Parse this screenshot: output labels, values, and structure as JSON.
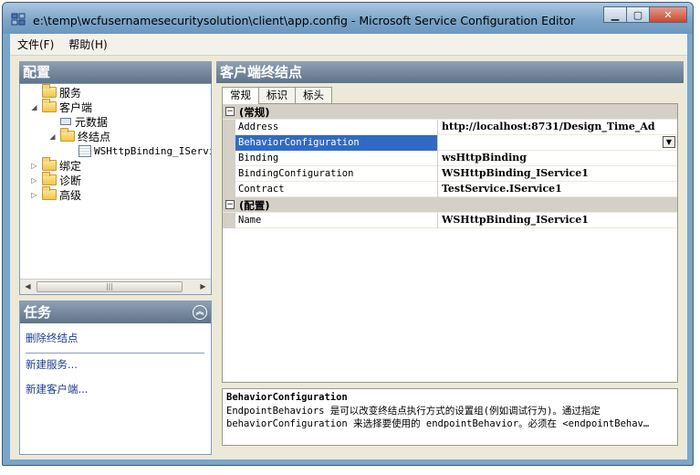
{
  "window": {
    "title": "e:\\temp\\wcfusernamesecuritysolution\\client\\app.config - Microsoft Service Configuration Editor",
    "controls": {
      "minimize": "▁",
      "maximize": "▢",
      "close": "✕"
    }
  },
  "menu": {
    "items": [
      "文件(F)",
      "帮助(H)"
    ]
  },
  "config_panel": {
    "title": "配置",
    "tree": [
      {
        "label": "服务",
        "level": 0,
        "icon": "folder-icon"
      },
      {
        "label": "客户端",
        "level": 0,
        "icon": "folder-icon",
        "expanded": true
      },
      {
        "label": "元数据",
        "level": 1,
        "icon": "metadata-icon"
      },
      {
        "label": "终结点",
        "level": 1,
        "icon": "folder-icon",
        "expanded": true
      },
      {
        "label": "WSHttpBinding_IServic",
        "level": 2,
        "icon": "endpoint-icon"
      },
      {
        "label": "绑定",
        "level": 0,
        "icon": "folder-icon"
      },
      {
        "label": "诊断",
        "level": 0,
        "icon": "folder-icon"
      },
      {
        "label": "高级",
        "level": 0,
        "icon": "folder-icon"
      }
    ]
  },
  "tasks_panel": {
    "title": "任务",
    "links": [
      "删除终结点",
      "新建服务...",
      "新建客户端..."
    ]
  },
  "endpoint_panel": {
    "title": "客户端终结点",
    "tabs": [
      "常规",
      "标识",
      "标头"
    ],
    "active_tab": "常规",
    "categories": [
      {
        "label": "(常规)",
        "rows": [
          {
            "name": "Address",
            "value": "http://localhost:8731/Design_Time_Ad"
          },
          {
            "name": "BehaviorConfiguration",
            "value": "",
            "selected": true,
            "dropdown": true
          },
          {
            "name": "Binding",
            "value": "wsHttpBinding"
          },
          {
            "name": "BindingConfiguration",
            "value": "WSHttpBinding_IService1"
          },
          {
            "name": "Contract",
            "value": "TestService.IService1"
          }
        ]
      },
      {
        "label": "(配置)",
        "rows": [
          {
            "name": "Name",
            "value": "WSHttpBinding_IService1"
          }
        ]
      }
    ],
    "description": {
      "title": "BehaviorConfiguration",
      "text": "EndpointBehaviors 是可以改变终结点执行方式的设置组(例如调试行为)。通过指定 behaviorConfiguration 来选择要使用的 endpointBehavior。必须在 <endpointBehav…"
    }
  },
  "colors": {
    "selection": "#316ac5",
    "link": "#1a3c8f",
    "panel_header": "#5f7389"
  }
}
